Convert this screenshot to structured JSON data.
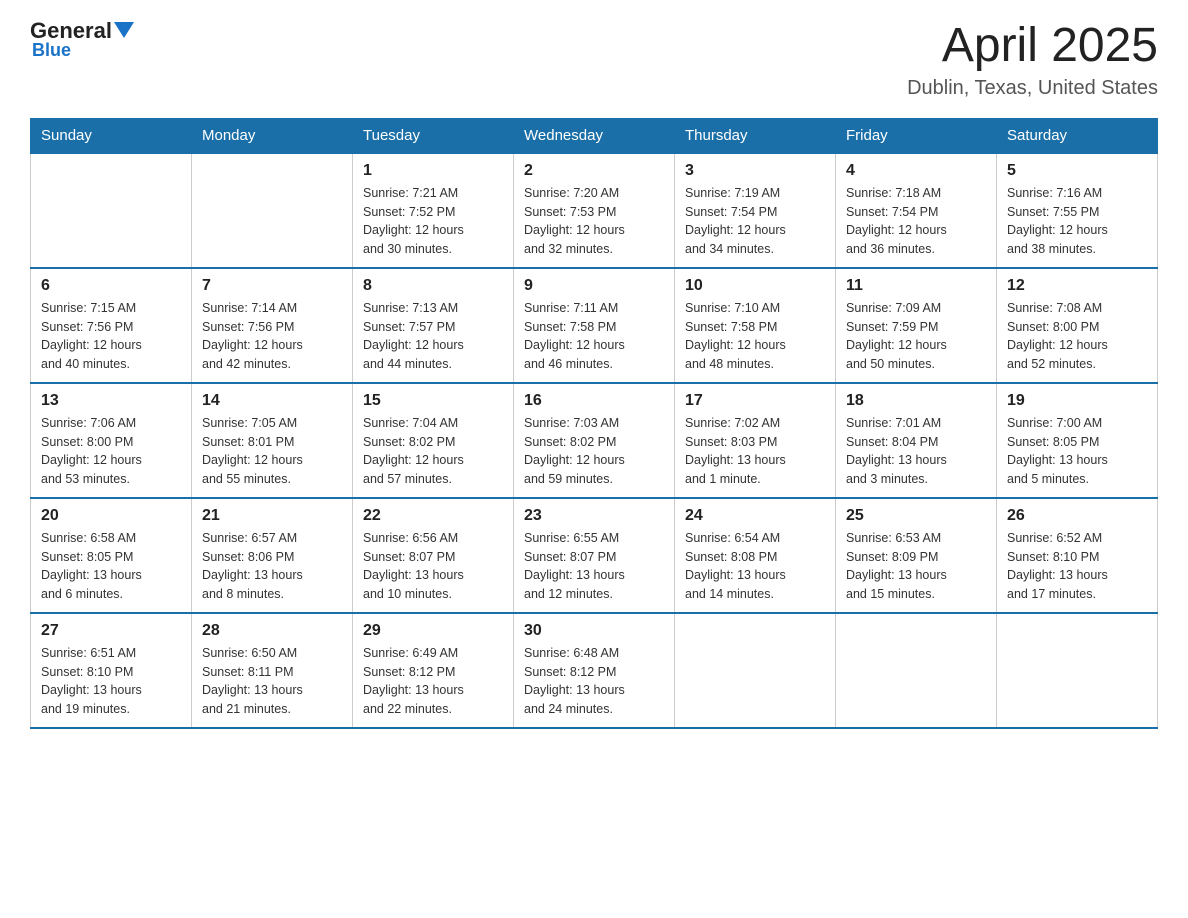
{
  "logo": {
    "general": "General",
    "blue": "Blue",
    "triangle_color": "#1a73c7"
  },
  "title": "April 2025",
  "subtitle": "Dublin, Texas, United States",
  "days_of_week": [
    "Sunday",
    "Monday",
    "Tuesday",
    "Wednesday",
    "Thursday",
    "Friday",
    "Saturday"
  ],
  "weeks": [
    [
      {
        "day": "",
        "info": ""
      },
      {
        "day": "",
        "info": ""
      },
      {
        "day": "1",
        "info": "Sunrise: 7:21 AM\nSunset: 7:52 PM\nDaylight: 12 hours\nand 30 minutes."
      },
      {
        "day": "2",
        "info": "Sunrise: 7:20 AM\nSunset: 7:53 PM\nDaylight: 12 hours\nand 32 minutes."
      },
      {
        "day": "3",
        "info": "Sunrise: 7:19 AM\nSunset: 7:54 PM\nDaylight: 12 hours\nand 34 minutes."
      },
      {
        "day": "4",
        "info": "Sunrise: 7:18 AM\nSunset: 7:54 PM\nDaylight: 12 hours\nand 36 minutes."
      },
      {
        "day": "5",
        "info": "Sunrise: 7:16 AM\nSunset: 7:55 PM\nDaylight: 12 hours\nand 38 minutes."
      }
    ],
    [
      {
        "day": "6",
        "info": "Sunrise: 7:15 AM\nSunset: 7:56 PM\nDaylight: 12 hours\nand 40 minutes."
      },
      {
        "day": "7",
        "info": "Sunrise: 7:14 AM\nSunset: 7:56 PM\nDaylight: 12 hours\nand 42 minutes."
      },
      {
        "day": "8",
        "info": "Sunrise: 7:13 AM\nSunset: 7:57 PM\nDaylight: 12 hours\nand 44 minutes."
      },
      {
        "day": "9",
        "info": "Sunrise: 7:11 AM\nSunset: 7:58 PM\nDaylight: 12 hours\nand 46 minutes."
      },
      {
        "day": "10",
        "info": "Sunrise: 7:10 AM\nSunset: 7:58 PM\nDaylight: 12 hours\nand 48 minutes."
      },
      {
        "day": "11",
        "info": "Sunrise: 7:09 AM\nSunset: 7:59 PM\nDaylight: 12 hours\nand 50 minutes."
      },
      {
        "day": "12",
        "info": "Sunrise: 7:08 AM\nSunset: 8:00 PM\nDaylight: 12 hours\nand 52 minutes."
      }
    ],
    [
      {
        "day": "13",
        "info": "Sunrise: 7:06 AM\nSunset: 8:00 PM\nDaylight: 12 hours\nand 53 minutes."
      },
      {
        "day": "14",
        "info": "Sunrise: 7:05 AM\nSunset: 8:01 PM\nDaylight: 12 hours\nand 55 minutes."
      },
      {
        "day": "15",
        "info": "Sunrise: 7:04 AM\nSunset: 8:02 PM\nDaylight: 12 hours\nand 57 minutes."
      },
      {
        "day": "16",
        "info": "Sunrise: 7:03 AM\nSunset: 8:02 PM\nDaylight: 12 hours\nand 59 minutes."
      },
      {
        "day": "17",
        "info": "Sunrise: 7:02 AM\nSunset: 8:03 PM\nDaylight: 13 hours\nand 1 minute."
      },
      {
        "day": "18",
        "info": "Sunrise: 7:01 AM\nSunset: 8:04 PM\nDaylight: 13 hours\nand 3 minutes."
      },
      {
        "day": "19",
        "info": "Sunrise: 7:00 AM\nSunset: 8:05 PM\nDaylight: 13 hours\nand 5 minutes."
      }
    ],
    [
      {
        "day": "20",
        "info": "Sunrise: 6:58 AM\nSunset: 8:05 PM\nDaylight: 13 hours\nand 6 minutes."
      },
      {
        "day": "21",
        "info": "Sunrise: 6:57 AM\nSunset: 8:06 PM\nDaylight: 13 hours\nand 8 minutes."
      },
      {
        "day": "22",
        "info": "Sunrise: 6:56 AM\nSunset: 8:07 PM\nDaylight: 13 hours\nand 10 minutes."
      },
      {
        "day": "23",
        "info": "Sunrise: 6:55 AM\nSunset: 8:07 PM\nDaylight: 13 hours\nand 12 minutes."
      },
      {
        "day": "24",
        "info": "Sunrise: 6:54 AM\nSunset: 8:08 PM\nDaylight: 13 hours\nand 14 minutes."
      },
      {
        "day": "25",
        "info": "Sunrise: 6:53 AM\nSunset: 8:09 PM\nDaylight: 13 hours\nand 15 minutes."
      },
      {
        "day": "26",
        "info": "Sunrise: 6:52 AM\nSunset: 8:10 PM\nDaylight: 13 hours\nand 17 minutes."
      }
    ],
    [
      {
        "day": "27",
        "info": "Sunrise: 6:51 AM\nSunset: 8:10 PM\nDaylight: 13 hours\nand 19 minutes."
      },
      {
        "day": "28",
        "info": "Sunrise: 6:50 AM\nSunset: 8:11 PM\nDaylight: 13 hours\nand 21 minutes."
      },
      {
        "day": "29",
        "info": "Sunrise: 6:49 AM\nSunset: 8:12 PM\nDaylight: 13 hours\nand 22 minutes."
      },
      {
        "day": "30",
        "info": "Sunrise: 6:48 AM\nSunset: 8:12 PM\nDaylight: 13 hours\nand 24 minutes."
      },
      {
        "day": "",
        "info": ""
      },
      {
        "day": "",
        "info": ""
      },
      {
        "day": "",
        "info": ""
      }
    ]
  ]
}
